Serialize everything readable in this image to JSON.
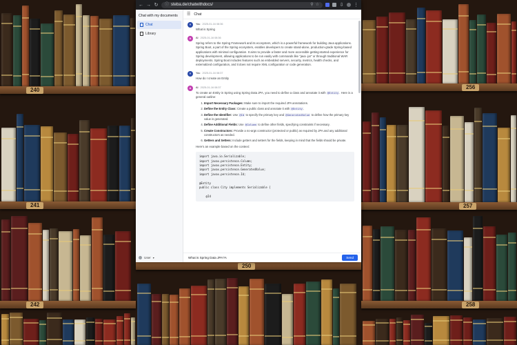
{
  "browser": {
    "url": "steba.de/chatwithdocs/"
  },
  "app": {
    "title": "Chat with my documents"
  },
  "sidebar": {
    "items": [
      {
        "label": "Chat"
      },
      {
        "label": "Library"
      }
    ],
    "user_label": "User"
  },
  "header": {
    "title": "Chat"
  },
  "messages": [
    {
      "author": "You",
      "timestamp": "2025-01-16 08:36",
      "text": "What is Spring"
    },
    {
      "author": "AI",
      "timestamp": "2025-01-16 08:36",
      "text": "Spring refers to the Spring Framework and its ecosystem, which is a powerful framework for building Java applications. Spring Boot, a part of the Spring ecosystem, enables developers to create stand-alone, production-grade Spring-based applications with minimal configuration. It aims to provide a faster and more accessible getting-started experience for Spring development, allowing applications to be run easily with commands like \"java -jar\" or through traditional WAR deployments. Spring Boot includes features such as embedded servers, security, metrics, health checks, and externalized configuration, and it does not require XML configuration or code generation."
    },
    {
      "author": "You",
      "timestamp": "2025-01-16 08:37",
      "text": "How do I create an Entity"
    },
    {
      "author": "AI",
      "timestamp": "2025-01-16 08:37",
      "intro_a": "To create an Entity in Spring using Spring Data JPA, you need to define a class and annotate it with ",
      "intro_code": "@Entity",
      "intro_b": ". Here is a general outline:",
      "steps": [
        {
          "title": "Import Necessary Packages:",
          "text": "Make sure to import the required JPA annotations."
        },
        {
          "title": "Define the Entity Class:",
          "text_a": "Create a public class and annotate it with ",
          "code": "@Entity",
          "text_b": "."
        },
        {
          "title": "Define the Identifier:",
          "text_a": "Use ",
          "code": "@Id",
          "text_b": " to specify the primary key and ",
          "code2": "@GeneratedValue",
          "text_c": " to define how the primary key value is generated."
        },
        {
          "title": "Define Additional Fields:",
          "text_a": "Use ",
          "code": "@Column",
          "text_b": " to define other fields, specifying constraints if necessary."
        },
        {
          "title": "Create Constructors:",
          "text": "Provide a no-args constructor (protected or public) as required by JPA and any additional constructors as needed."
        },
        {
          "title": "Getters and Setters:",
          "text": "Include getters and setters for the fields, keeping in mind that the fields should be private."
        }
      ],
      "example_label": "Here's an example based on the context:",
      "code_lines": [
        "import java.io.Serializable;",
        "import javax.persistence.Column;",
        "import javax.persistence.Entity;",
        "import javax.persistence.GeneratedValue;",
        "import javax.persistence.Id;",
        "",
        "@Entity",
        "public class City implements Serializable {",
        "",
        "    @Id"
      ]
    }
  ],
  "composer": {
    "value": "What is Spring Data JPA?A",
    "send_label": "Send"
  },
  "shelf_labels": [
    "240",
    "241",
    "242",
    "250",
    "256",
    "257",
    "258"
  ],
  "colors": {
    "accent": "#2563eb",
    "you_avatar": "#2848a8",
    "ai_avatar": "#c23fb1"
  }
}
